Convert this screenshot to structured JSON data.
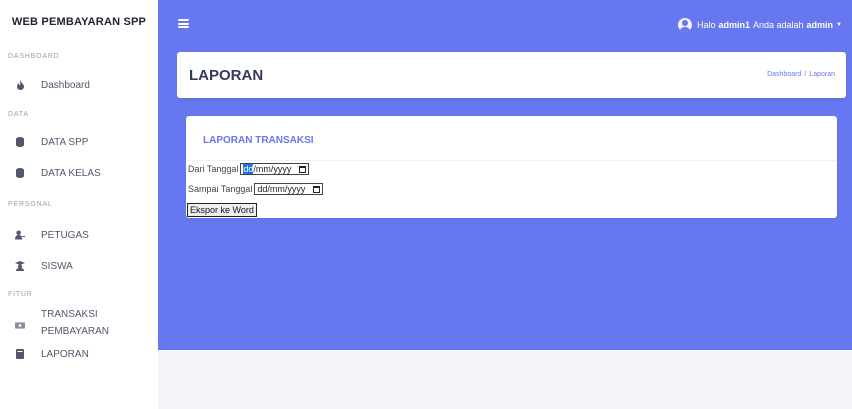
{
  "sidebar": {
    "brand": "WEB PEMBAYARAN SPP",
    "sections": {
      "dashboard": "DASHBOARD",
      "data": "DATA",
      "personal": "PERSONAL",
      "fitur": "FITUR"
    },
    "items": [
      {
        "label": "Dashboard",
        "icon": "fire-icon"
      },
      {
        "label": "DATA SPP",
        "icon": "database-icon"
      },
      {
        "label": "DATA KELAS",
        "icon": "database-icon"
      },
      {
        "label": "PETUGAS",
        "icon": "user-tie-icon"
      },
      {
        "label": "SISWA",
        "icon": "graduation-cap-icon"
      },
      {
        "label": "TRANSAKSI",
        "label2": "PEMBAYARAN",
        "icon": "money-icon"
      },
      {
        "label": "LAPORAN",
        "icon": "book-icon"
      }
    ]
  },
  "header": {
    "greeting": "Halo",
    "username": "admin1",
    "role_text": "Anda adalah",
    "role": "admin"
  },
  "page": {
    "title": "LAPORAN",
    "breadcrumb": [
      "Dashboard",
      "Laporan"
    ]
  },
  "report": {
    "title": "LAPORAN TRANSAKSI",
    "from_label": "Dari Tanggal",
    "from_placeholder_hl": "dd",
    "from_placeholder_rest": "/mm/yyyy",
    "to_label": "Sampai Tanggal",
    "to_placeholder": "dd/mm/yyyy",
    "export_label": "Ekspor ke Word"
  },
  "colors": {
    "primary": "#6777ef",
    "background": "#f4f5fa",
    "sidebar": "#ffffff"
  }
}
